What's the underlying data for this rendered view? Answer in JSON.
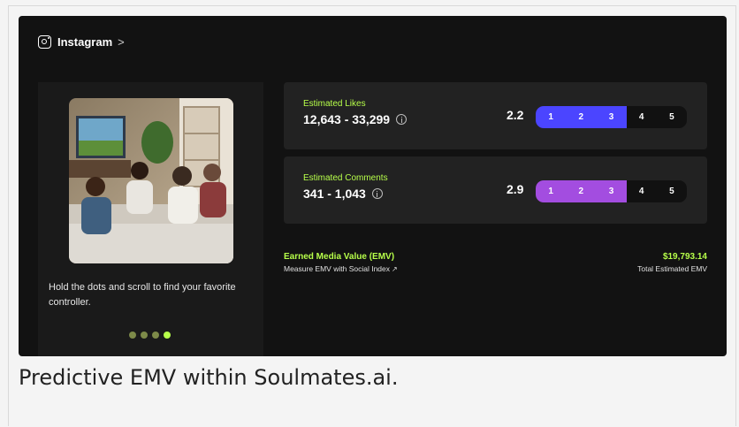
{
  "header": {
    "platform": "Instagram",
    "chevron": ">",
    "icon": "instagram-icon"
  },
  "carousel": {
    "caption": "Hold the dots and scroll to find your favorite controller.",
    "dot_count": 4,
    "active_dot": 4
  },
  "metrics": [
    {
      "label": "Estimated Likes",
      "range": "12,643 - 33,299",
      "score": "2.2",
      "score_value": 2.2,
      "scale": [
        "1",
        "2",
        "3",
        "4",
        "5"
      ],
      "fill_color": "#4b45ff"
    },
    {
      "label": "Estimated Comments",
      "range": "341 - 1,043",
      "score": "2.9",
      "score_value": 2.9,
      "scale": [
        "1",
        "2",
        "3",
        "4",
        "5"
      ],
      "fill_color": "#a34de0"
    }
  ],
  "emv": {
    "label": "Earned Media Value (EMV)",
    "link_text": "Measure EMV with Social Index",
    "link_icon": "↗",
    "value": "$19,793.14",
    "value_label": "Total Estimated EMV"
  },
  "figure_caption": "Predictive EMV within Soulmates.ai.",
  "colors": {
    "accent": "#b7ff4a",
    "card_bg": "#222222",
    "app_bg": "#121212"
  }
}
